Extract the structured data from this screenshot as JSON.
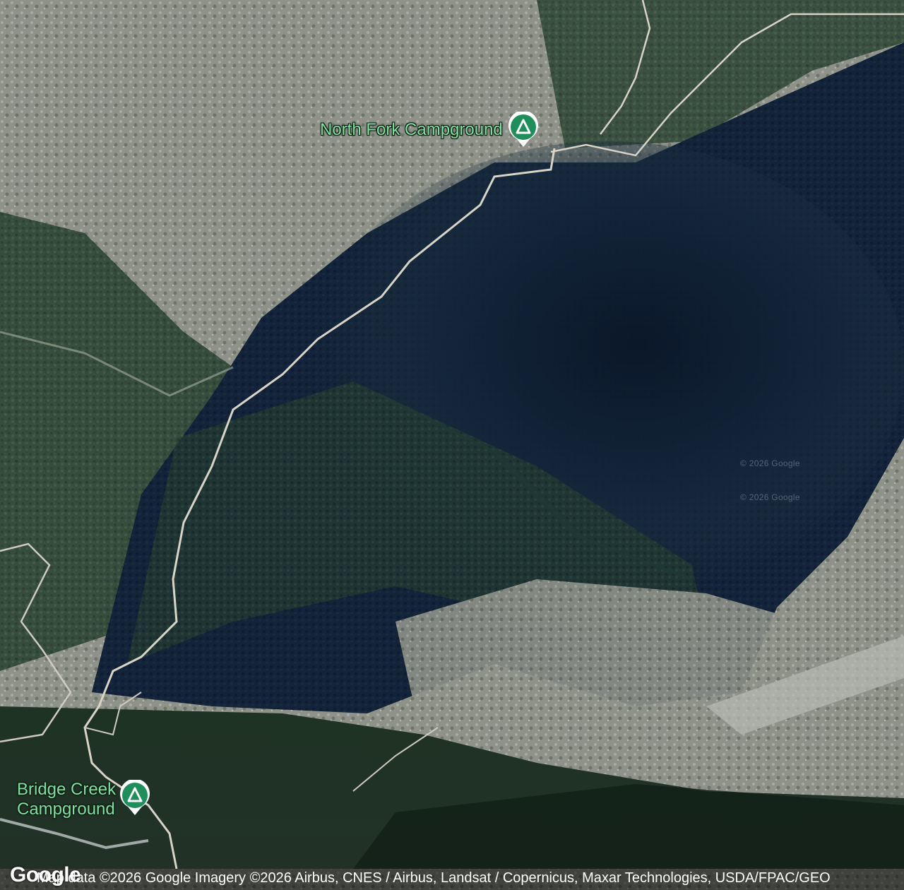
{
  "map": {
    "type": "satellite",
    "places": [
      {
        "name": "North Fork Campground",
        "category": "campground",
        "icon": "campground-icon"
      },
      {
        "name": "Bridge Creek\nCampground",
        "category": "campground",
        "icon": "campground-icon"
      }
    ],
    "watermarks": [
      "© 2026 Google",
      "© 2026 Google"
    ]
  },
  "footer": {
    "logo": "Google",
    "attribution": "Map data ©2026 Google Imagery ©2026 Airbus, CNES / Airbus, Landsat / Copernicus, Maxar Technologies, USDA/FPAC/GEO"
  },
  "colors": {
    "pin_fill": "#1e8e5a",
    "label_text": "#7fe0a0",
    "road": "#d8d4c8"
  }
}
